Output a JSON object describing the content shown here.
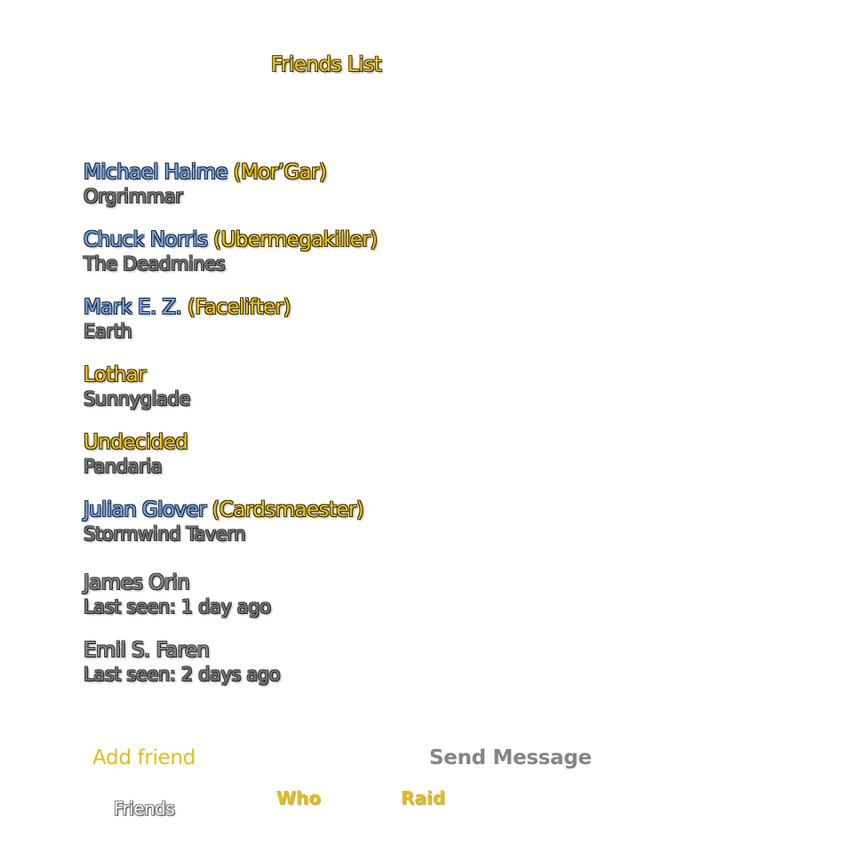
{
  "window": {
    "title": "Friends List"
  },
  "friends": [
    {
      "real_name": "Michael Haime",
      "character": "(Mor’Gar)",
      "location": "Orgrimmar",
      "status": "online"
    },
    {
      "real_name": "Chuck Norris",
      "character": "(Ubermegakiller)",
      "location": "The Deadmines",
      "status": "online"
    },
    {
      "real_name": "Mark E. Z.",
      "character": "(Facelifter)",
      "location": "Earth",
      "status": "online"
    },
    {
      "real_name": "",
      "character": "Lothar",
      "location": "Sunnyglade",
      "status": "online"
    },
    {
      "real_name": "",
      "character": "Undecided",
      "location": "Pandaria",
      "status": "online"
    },
    {
      "real_name": "Julian Glover",
      "character": "(Cardsmaester)",
      "location": "Stormwind Tavern",
      "status": "online"
    },
    {
      "name": "James Orin",
      "last_seen": "Last seen: 1 day ago",
      "status": "offline"
    },
    {
      "name": "Emil S. Faren",
      "last_seen": "Last seen: 2 days ago",
      "status": "offline"
    }
  ],
  "actions": {
    "add_friend": "Add friend",
    "send_message": "Send Message"
  },
  "tabs": [
    {
      "label": "Friends",
      "active": true
    },
    {
      "label": "Who",
      "active": false
    },
    {
      "label": "Raid",
      "active": false
    }
  ],
  "colors": {
    "gold": "#f2c81a",
    "realid_blue": "#7aa7e0",
    "offline_gray": "#8a8a8a",
    "button_gray": "#858585"
  }
}
